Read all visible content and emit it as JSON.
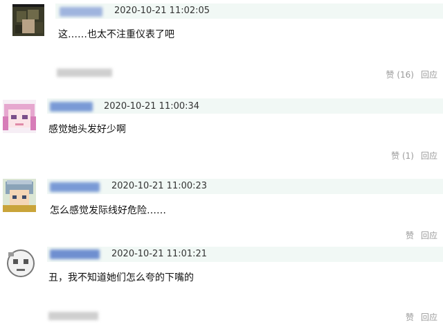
{
  "comments": [
    {
      "time": "2020-10-21 11:02:05",
      "text": "这……也太不注重仪表了吧",
      "like_label": "赞",
      "like_count": "(16)",
      "reply_label": "回应"
    },
    {
      "time": "2020-10-21 11:00:34",
      "text": "感觉她头发好少啊",
      "like_label": "赞",
      "like_count": "(1)",
      "reply_label": "回应"
    },
    {
      "time": "2020-10-21 11:00:23",
      "text": "怎么感觉发际线好危险……",
      "like_label": "赞",
      "like_count": "",
      "reply_label": "回应"
    },
    {
      "time": "2020-10-21 11:01:21",
      "text": "丑，我不知道她们怎么夸的下嘴的",
      "like_label": "赞",
      "like_count": "",
      "reply_label": "回应"
    }
  ],
  "colors": {
    "header_bg": "#f1f8f5",
    "name_blur": "#7a9ad6",
    "action_gray": "#9a9a9a"
  }
}
